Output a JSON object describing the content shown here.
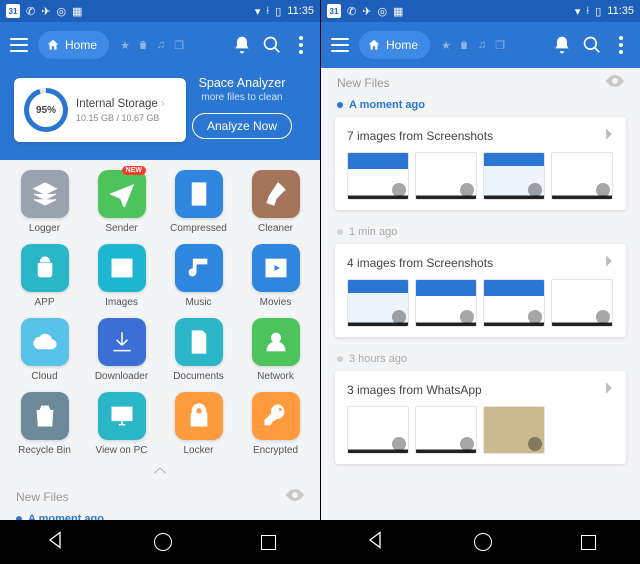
{
  "status": {
    "cal": "31",
    "time": "11:35"
  },
  "appbar": {
    "home": "Home"
  },
  "storage": {
    "percent": "95%",
    "title": "Internal Storage",
    "usage": "10.15 GB / 10.67 GB",
    "analyzer_title": "Space Analyzer",
    "analyzer_sub": "more files to clean",
    "analyze_btn": "Analyze Now"
  },
  "grid": [
    {
      "label": "Logger",
      "color": "c-grey",
      "icon": "layers"
    },
    {
      "label": "Sender",
      "color": "c-green",
      "icon": "plane",
      "badge": "NEW"
    },
    {
      "label": "Compressed",
      "color": "c-blue",
      "icon": "zip"
    },
    {
      "label": "Cleaner",
      "color": "c-brown",
      "icon": "broom"
    },
    {
      "label": "APP",
      "color": "c-teal",
      "icon": "android"
    },
    {
      "label": "Images",
      "color": "c-cyan",
      "icon": "image"
    },
    {
      "label": "Music",
      "color": "c-blue",
      "icon": "music"
    },
    {
      "label": "Movies",
      "color": "c-blue",
      "icon": "movie"
    },
    {
      "label": "Cloud",
      "color": "c-sky",
      "icon": "cloud"
    },
    {
      "label": "Downloader",
      "color": "c-dblue",
      "icon": "download"
    },
    {
      "label": "Documents",
      "color": "c-teal",
      "icon": "doc"
    },
    {
      "label": "Network",
      "color": "c-green",
      "icon": "net"
    },
    {
      "label": "Recycle Bin",
      "color": "c-slate",
      "icon": "trash"
    },
    {
      "label": "View on PC",
      "color": "c-teal",
      "icon": "pc"
    },
    {
      "label": "Locker",
      "color": "c-orange",
      "icon": "lock"
    },
    {
      "label": "Encrypted",
      "color": "c-orange",
      "icon": "key"
    }
  ],
  "sections": {
    "newfiles": "New Files",
    "moment": "A moment ago",
    "one_min": "1 min ago",
    "three_hr": "3 hours ago"
  },
  "cards": {
    "c1": "7 images from Screenshots",
    "c2": "4 images from Screenshots",
    "c3": "3 images from WhatsApp"
  }
}
